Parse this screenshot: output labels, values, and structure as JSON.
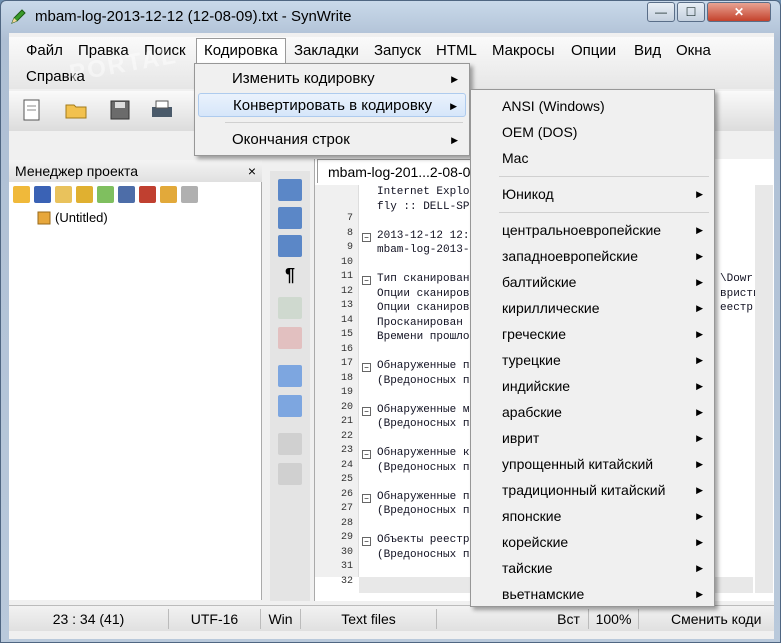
{
  "window": {
    "title": "mbam-log-2013-12-12 (12-08-09).txt - SynWrite",
    "min_label": "—",
    "max_label": "☐",
    "close_label": "✕"
  },
  "menubar": {
    "items": [
      "Файл",
      "Правка",
      "Поиск",
      "Кодировка",
      "Закладки",
      "Запуск",
      "HTML",
      "Макросы",
      "Опции",
      "Вид",
      "Окна"
    ],
    "row2": [
      "Справка"
    ]
  },
  "watermark": "PORTAL",
  "panel": {
    "title": "Менеджер проекта",
    "close": "×",
    "tree_item": "(Untitled)"
  },
  "editor": {
    "tab": "mbam-log-201...2-08-09).txt",
    "line_numbers": [
      "7",
      "8",
      "9",
      "10",
      "11",
      "12",
      "13",
      "14",
      "15",
      "16",
      "17",
      "18",
      "19",
      "20",
      "21",
      "22",
      "23",
      "24",
      "25",
      "26",
      "27",
      "28",
      "29",
      "30",
      "31",
      "32"
    ],
    "lines": [
      "Internet Explo",
      "fly :: DELL-SP",
      "",
      "2013-12-12 12:",
      "mbam-log-2013-",
      "",
      "Тип сканирован",
      "Опции сканиров",
      "Опции сканиров",
      "Просканирован",
      "Времени прошло",
      "",
      "Обнаруженные п",
      "(Вредоносных п",
      "",
      "Обнаруженные м",
      "(Вредоносных п",
      "",
      "Обнаруженные к",
      "(Вредоносных п",
      "",
      "Обнаруженные п",
      "(Вредоносных п",
      "",
      "Объекты реестр",
      "(Вредоносных п"
    ],
    "right_fragments": {
      "l13": "\\Dowr",
      "l14": "вристи",
      "l15": "еестр"
    }
  },
  "statusbar": {
    "position": "23 : 34 (41)",
    "encoding": "UTF-16",
    "lineend": "Win",
    "lexer": "Text files",
    "mode": "Вст",
    "zoom": "100%",
    "hint": "Сменить коди"
  },
  "encoding_menu": {
    "items": [
      {
        "label": "Изменить кодировку",
        "submenu": true
      },
      {
        "label": "Конвертировать в кодировку",
        "submenu": true,
        "highlighted": true
      },
      {
        "label": "Окончания строк",
        "submenu": true
      }
    ]
  },
  "convert_menu": {
    "top": [
      "ANSI (Windows)",
      "OEM (DOS)",
      "Mac"
    ],
    "unicode": "Юникод",
    "groups": [
      "центральноевропейские",
      "западноевропейские",
      "балтийские",
      "кириллические",
      "греческие",
      "турецкие",
      "индийские",
      "арабские",
      "иврит",
      "упрощенный китайский",
      "традиционный китайский",
      "японские",
      "корейские",
      "тайские",
      "вьетнамские"
    ]
  }
}
